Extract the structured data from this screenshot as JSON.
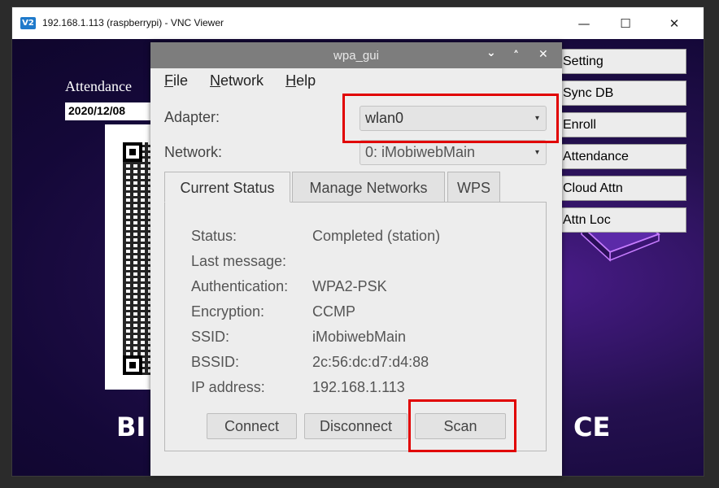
{
  "vnc": {
    "logo_text": "V2",
    "title": "192.168.1.113 (raspberrypi) - VNC Viewer",
    "minimize": "—",
    "maximize": "☐",
    "close": "✕"
  },
  "desktop": {
    "attendance_label": "Attendance",
    "date": "2020/12/08",
    "banner_left": "BI",
    "banner_right": "CE",
    "side_buttons": [
      "Setting",
      "Sync DB",
      "Enroll",
      "Attendance",
      "Cloud Attn",
      "Attn Loc"
    ]
  },
  "wpa_gui": {
    "title": "wpa_gui",
    "controls": {
      "menu": "⌄",
      "maximize": "˄",
      "close": "✕"
    },
    "menu": [
      {
        "mnemonic": "F",
        "rest": "ile"
      },
      {
        "mnemonic": "N",
        "rest": "etwork"
      },
      {
        "mnemonic": "H",
        "rest": "elp"
      }
    ],
    "adapter_label": "Adapter:",
    "adapter_value": "wlan0",
    "network_label": "Network:",
    "network_value": "0: iMobiwebMain",
    "tabs": [
      "Current Status",
      "Manage Networks",
      "WPS"
    ],
    "active_tab": "Current Status",
    "status_rows": [
      {
        "label": "Status:",
        "value": "Completed (station)"
      },
      {
        "label": "Last message:",
        "value": ""
      },
      {
        "label": "Authentication:",
        "value": "WPA2-PSK"
      },
      {
        "label": "Encryption:",
        "value": "CCMP"
      },
      {
        "label": "SSID:",
        "value": "iMobiwebMain"
      },
      {
        "label": "BSSID:",
        "value": "2c:56:dc:d7:d4:88"
      },
      {
        "label": "IP address:",
        "value": "192.168.1.113"
      }
    ],
    "buttons": {
      "connect": "Connect",
      "disconnect": "Disconnect",
      "scan": "Scan"
    }
  },
  "colors": {
    "highlight": "#e10000",
    "desktop_bg": "#1a0a40",
    "dialog_bg": "#ededed"
  }
}
